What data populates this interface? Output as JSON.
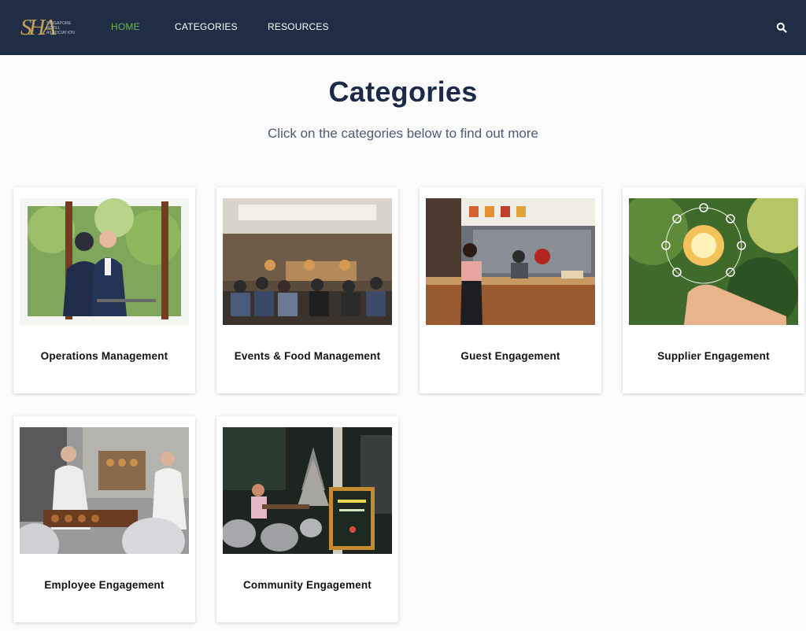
{
  "brand": {
    "monogram": "SHA",
    "name_lines": [
      "SINGAPORE",
      "HOTEL",
      "ASSOCIATION"
    ]
  },
  "nav": {
    "items": [
      {
        "label": "HOME",
        "active": true
      },
      {
        "label": "CATEGORIES",
        "active": false
      },
      {
        "label": "RESOURCES",
        "active": false
      }
    ],
    "search_icon": "search-icon"
  },
  "page": {
    "title": "Categories",
    "subtitle": "Click on the categories below to find out more"
  },
  "categories": [
    {
      "label": "Operations Management"
    },
    {
      "label": "Events & Food Management"
    },
    {
      "label": "Guest Engagement"
    },
    {
      "label": "Supplier Engagement"
    },
    {
      "label": "Employee Engagement"
    },
    {
      "label": "Community Engagement"
    }
  ],
  "colors": {
    "nav_bg": "#1f2e45",
    "nav_active": "#6cb552",
    "title": "#1b2a47",
    "logo_gold": "#c7a258"
  }
}
